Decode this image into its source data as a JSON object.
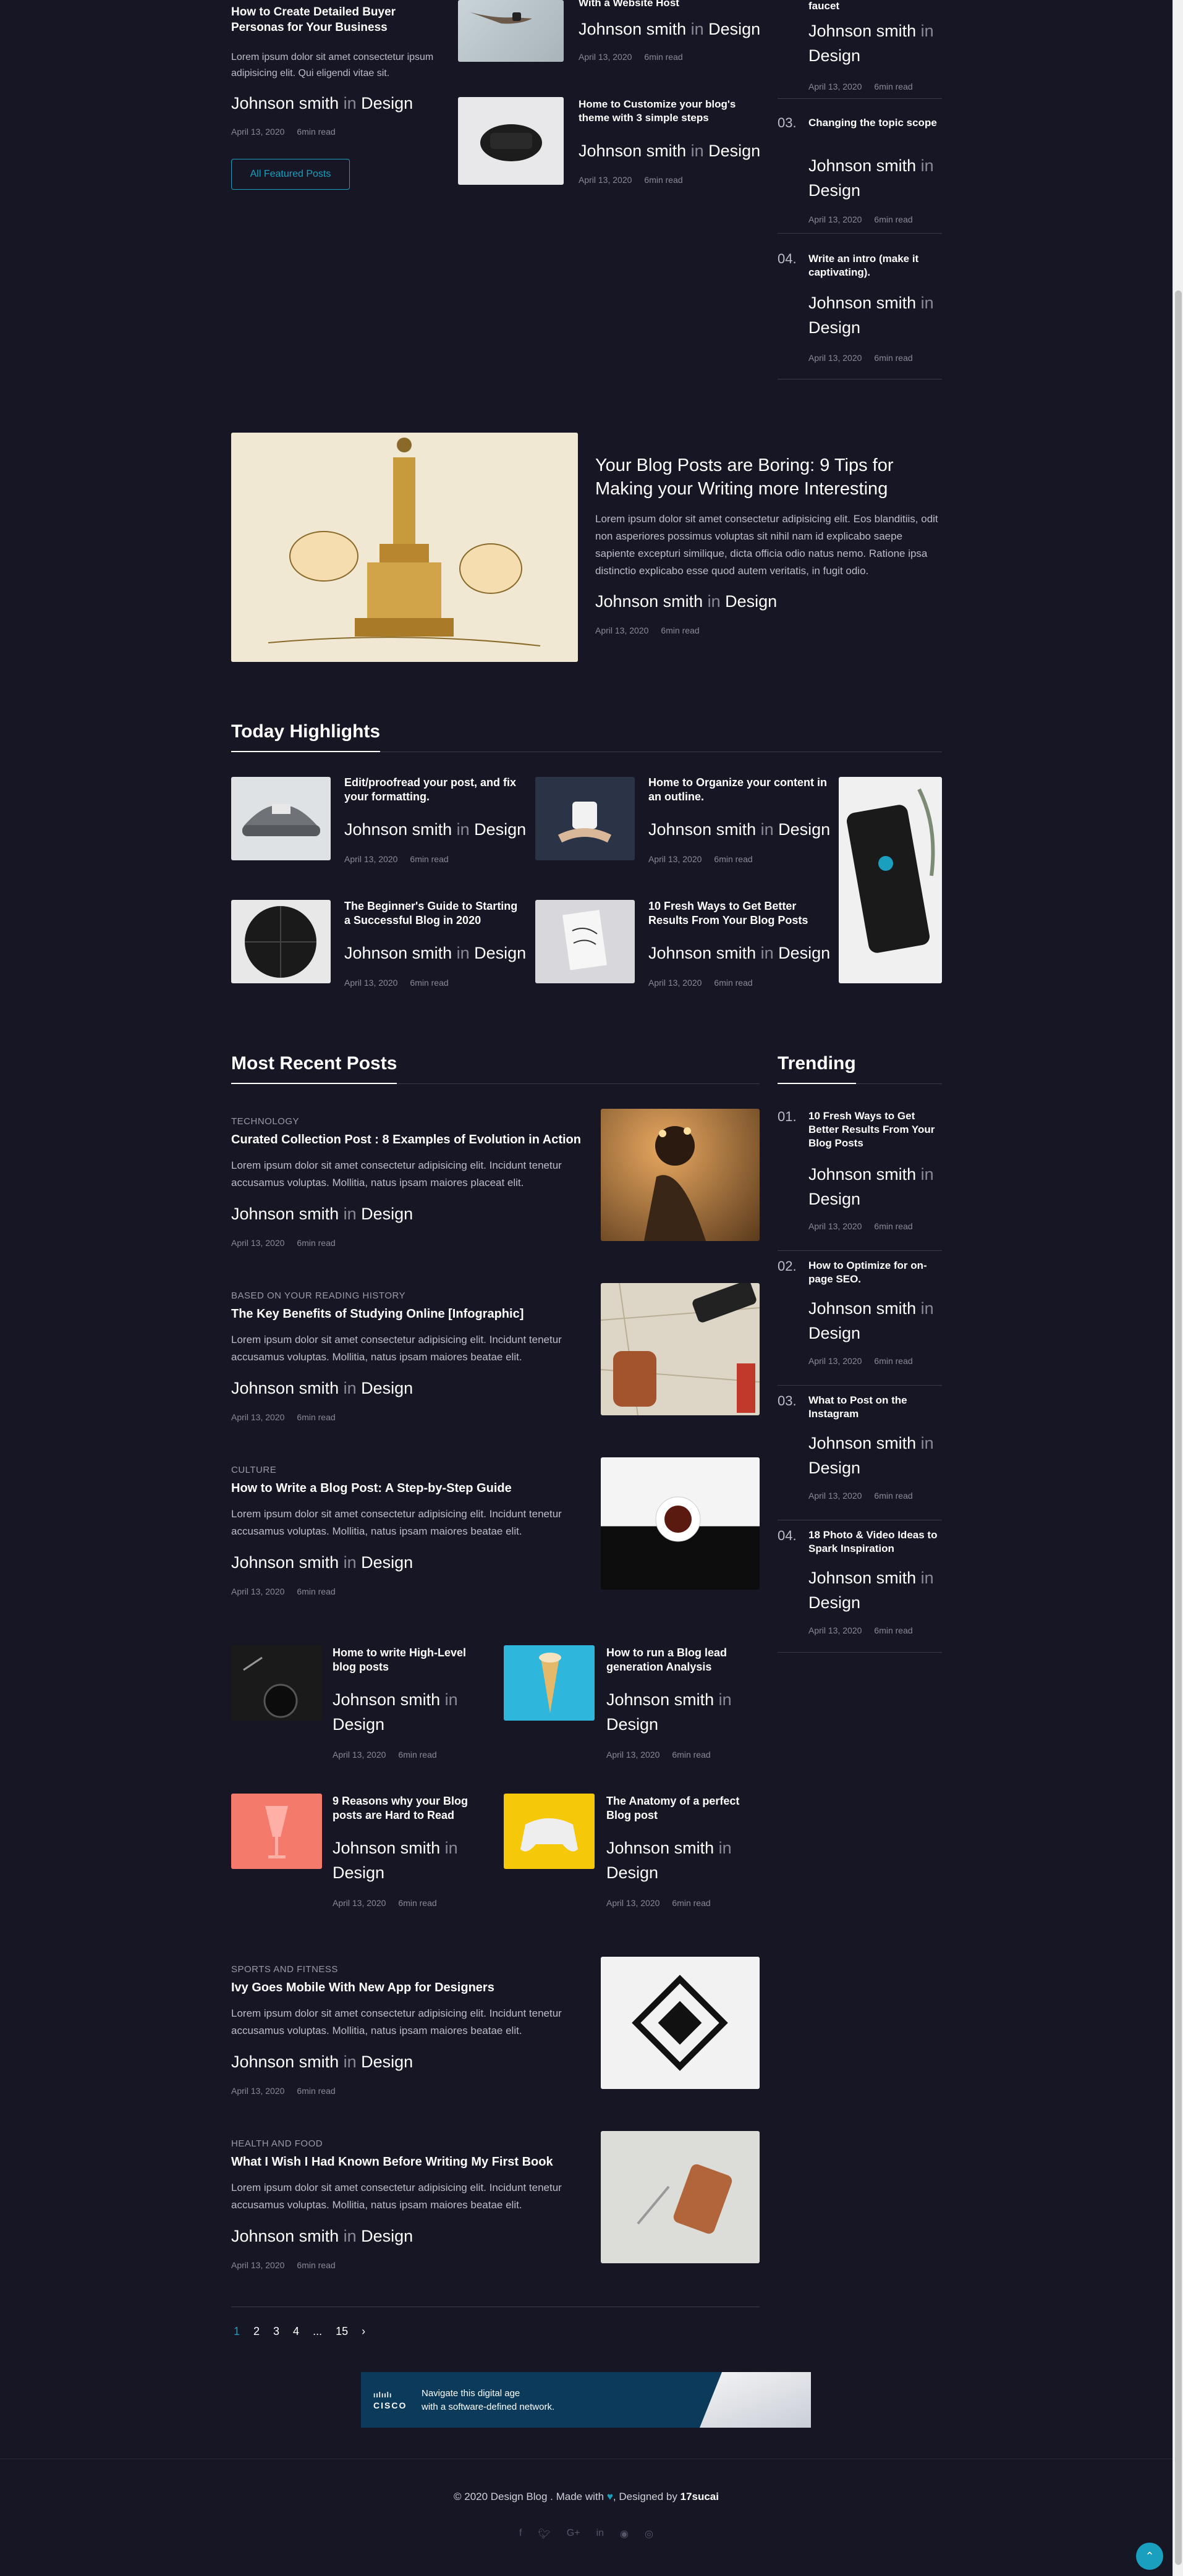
{
  "featured": {
    "left_post": {
      "title": "How to Create Detailed Buyer Personas for Your Business",
      "excerpt": "Lorem ipsum dolor sit amet consectetur ipsum adipisicing elit. Qui eligendi vitae sit.",
      "author": "Johnson smith",
      "in": "in",
      "category": "Design",
      "date": "April 13, 2020",
      "read": "6min read"
    },
    "all_button": "All Featured Posts",
    "mid_posts": [
      {
        "title": "With a Website Host",
        "author": "Johnson smith",
        "in": "in",
        "category": "Design",
        "date": "April 13, 2020",
        "read": "6min read"
      },
      {
        "title": "Home to Customize your blog's theme with 3 simple steps",
        "author": "Johnson smith",
        "in": "in",
        "category": "Design",
        "date": "April 13, 2020",
        "read": "6min read"
      }
    ],
    "right_posts": [
      {
        "num": "",
        "title": "faucet",
        "author": "Johnson smith",
        "in": "in",
        "category": "Design",
        "date": "April 13, 2020",
        "read": "6min read"
      },
      {
        "num": "03.",
        "title": "Changing the topic scope",
        "author": "Johnson smith",
        "in": "in",
        "category": "Design",
        "date": "April 13, 2020",
        "read": "6min read"
      },
      {
        "num": "04.",
        "title": "Write an intro (make it captivating).",
        "author": "Johnson smith",
        "in": "in",
        "category": "Design",
        "date": "April 13, 2020",
        "read": "6min read"
      }
    ]
  },
  "hero": {
    "title": "Your Blog Posts are Boring: 9 Tips for Making your Writing more Interesting",
    "excerpt": "Lorem ipsum dolor sit amet consectetur adipisicing elit. Eos blanditiis, odit non asperiores possimus voluptas sit nihil nam id explicabo saepe sapiente excepturi similique, dicta officia odio natus nemo. Ratione ipsa distinctio explicabo esse quod autem veritatis, in fugit odio.",
    "author": "Johnson smith",
    "in": "in",
    "category": "Design",
    "date": "April 13, 2020",
    "read": "6min read"
  },
  "highlights": {
    "heading": "Today Highlights",
    "posts": [
      {
        "title": "Edit/proofread your post, and fix your formatting.",
        "author": "Johnson smith",
        "in": "in",
        "category": "Design",
        "date": "April 13, 2020",
        "read": "6min read"
      },
      {
        "title": "Home to Organize your content in an outline.",
        "author": "Johnson smith",
        "in": "in",
        "category": "Design",
        "date": "April 13, 2020",
        "read": "6min read"
      },
      {
        "title": "The Beginner's Guide to Starting a Successful Blog in 2020",
        "author": "Johnson smith",
        "in": "in",
        "category": "Design",
        "date": "April 13, 2020",
        "read": "6min read"
      },
      {
        "title": "10 Fresh Ways to Get Better Results From Your Blog Posts",
        "author": "Johnson smith",
        "in": "in",
        "category": "Design",
        "date": "April 13, 2020",
        "read": "6min read"
      }
    ]
  },
  "recent": {
    "heading": "Most Recent Posts",
    "large_posts": [
      {
        "category_label": "TECHNOLOGY",
        "title": "Curated Collection Post : 8 Examples of Evolution in Action",
        "excerpt": "Lorem ipsum dolor sit amet consectetur adipisicing elit. Incidunt tenetur accusamus voluptas. Mollitia, natus ipsam maiores placeat elit.",
        "author": "Johnson smith",
        "in": "in",
        "category": "Design",
        "date": "April 13, 2020",
        "read": "6min read"
      },
      {
        "category_label": "BASED ON YOUR READING HISTORY",
        "title": "The Key Benefits of Studying Online [Infographic]",
        "excerpt": "Lorem ipsum dolor sit amet consectetur adipisicing elit. Incidunt tenetur accusamus voluptas. Mollitia, natus ipsam maiores beatae elit.",
        "author": "Johnson smith",
        "in": "in",
        "category": "Design",
        "date": "April 13, 2020",
        "read": "6min read"
      },
      {
        "category_label": "CULTURE",
        "title": "How to Write a Blog Post: A Step-by-Step Guide",
        "excerpt": "Lorem ipsum dolor sit amet consectetur adipisicing elit. Incidunt tenetur accusamus voluptas. Mollitia, natus ipsam maiores beatae elit.",
        "author": "Johnson smith",
        "in": "in",
        "category": "Design",
        "date": "April 13, 2020",
        "read": "6min read"
      }
    ],
    "grid_posts": [
      {
        "title": "Home to write High-Level blog posts",
        "author": "Johnson smith",
        "in": "in",
        "category": "Design",
        "date": "April 13, 2020",
        "read": "6min read"
      },
      {
        "title": "How to run a Blog lead generation Analysis",
        "author": "Johnson smith",
        "in": "in",
        "category": "Design",
        "date": "April 13, 2020",
        "read": "6min read"
      },
      {
        "title": "9 Reasons why your Blog posts are Hard to Read",
        "author": "Johnson smith",
        "in": "in",
        "category": "Design",
        "date": "April 13, 2020",
        "read": "6min read"
      },
      {
        "title": "The Anatomy of a perfect Blog post",
        "author": "Johnson smith",
        "in": "in",
        "category": "Design",
        "date": "April 13, 2020",
        "read": "6min read"
      }
    ],
    "bottom_posts": [
      {
        "category_label": "SPORTS AND FITNESS",
        "title": "Ivy Goes Mobile With New App for Designers",
        "excerpt": "Lorem ipsum dolor sit amet consectetur adipisicing elit. Incidunt tenetur accusamus voluptas. Mollitia, natus ipsam maiores beatae elit.",
        "author": "Johnson smith",
        "in": "in",
        "category": "Design",
        "date": "April 13, 2020",
        "read": "6min read"
      },
      {
        "category_label": "HEALTH AND FOOD",
        "title": "What I Wish I Had Known Before Writing My First Book",
        "excerpt": "Lorem ipsum dolor sit amet consectetur adipisicing elit. Incidunt tenetur accusamus voluptas. Mollitia, natus ipsam maiores beatae elit.",
        "author": "Johnson smith",
        "in": "in",
        "category": "Design",
        "date": "April 13, 2020",
        "read": "6min read"
      }
    ]
  },
  "trending": {
    "heading": "Trending",
    "posts": [
      {
        "num": "01.",
        "title": "10 Fresh Ways to Get Better Results From Your Blog Posts",
        "author": "Johnson smith",
        "in": "in",
        "category": "Design",
        "date": "April 13, 2020",
        "read": "6min read"
      },
      {
        "num": "02.",
        "title": "How to Optimize for on-page SEO.",
        "author": "Johnson smith",
        "in": "in",
        "category": "Design",
        "date": "April 13, 2020",
        "read": "6min read"
      },
      {
        "num": "03.",
        "title": "What to Post on the Instagram",
        "author": "Johnson smith",
        "in": "in",
        "category": "Design",
        "date": "April 13, 2020",
        "read": "6min read"
      },
      {
        "num": "04.",
        "title": "18 Photo & Video Ideas to Spark Inspiration",
        "author": "Johnson smith",
        "in": "in",
        "category": "Design",
        "date": "April 13, 2020",
        "read": "6min read"
      }
    ]
  },
  "pagination": {
    "pages": [
      "1",
      "2",
      "3",
      "4",
      "...",
      "15"
    ],
    "next": "›"
  },
  "ad": {
    "brand": "CISCO",
    "line1": "Navigate this digital age",
    "line2": "with a software-defined network."
  },
  "footer": {
    "copyright": "© 2020 Design Blog . Made with",
    "heart": "♥",
    "designed_by": ", Designed by",
    "designer": "17sucai"
  },
  "social": [
    "f",
    "t",
    "G+",
    "in",
    "gh",
    "dr"
  ],
  "colors": {
    "accent": "#1b9fbf",
    "background": "#171624"
  }
}
